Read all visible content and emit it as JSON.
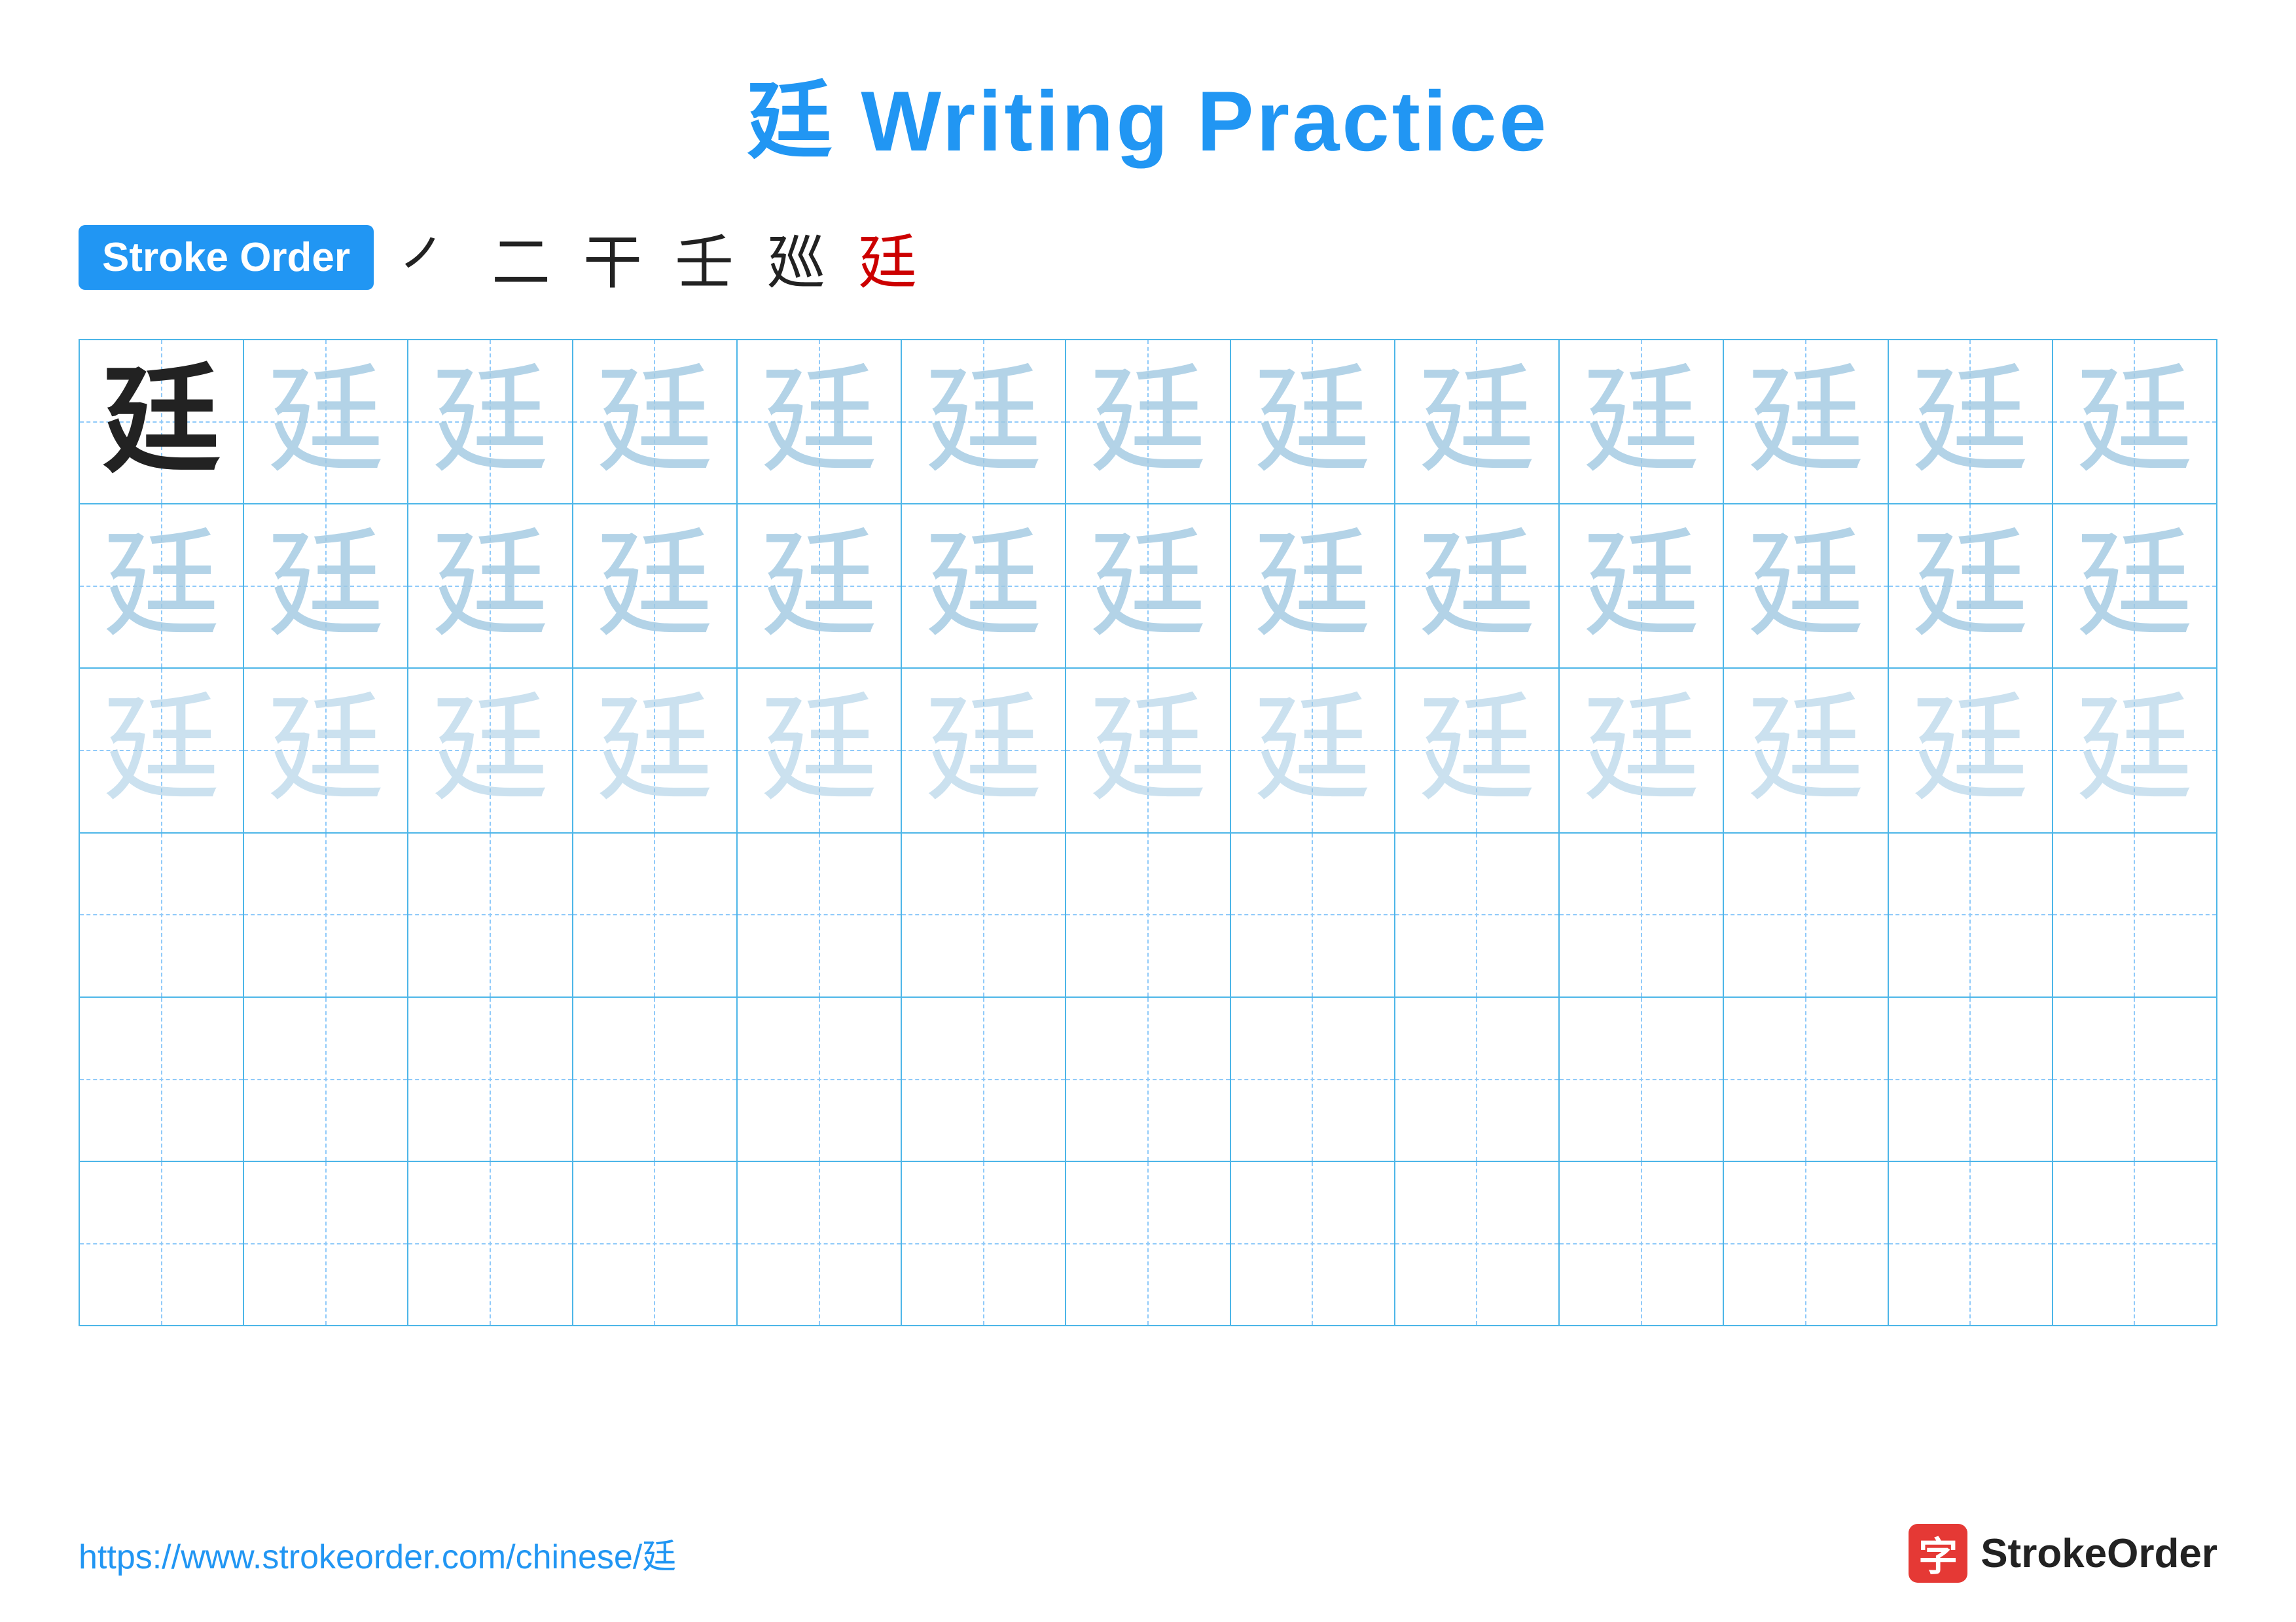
{
  "title": "廷 Writing Practice",
  "stroke_order": {
    "label": "Stroke Order",
    "steps": [
      "㇒",
      "二",
      "干",
      "壬",
      "廵",
      "廷"
    ]
  },
  "character": "廷",
  "grid": {
    "rows": 6,
    "cols": 13,
    "cells": [
      [
        "solid",
        "light1",
        "light1",
        "light1",
        "light1",
        "light1",
        "light1",
        "light1",
        "light1",
        "light1",
        "light1",
        "light1",
        "light1"
      ],
      [
        "light1",
        "light1",
        "light1",
        "light1",
        "light1",
        "light1",
        "light1",
        "light1",
        "light1",
        "light1",
        "light1",
        "light1",
        "light1"
      ],
      [
        "light2",
        "light2",
        "light2",
        "light2",
        "light2",
        "light2",
        "light2",
        "light2",
        "light2",
        "light2",
        "light2",
        "light2",
        "light2"
      ],
      [
        "empty",
        "empty",
        "empty",
        "empty",
        "empty",
        "empty",
        "empty",
        "empty",
        "empty",
        "empty",
        "empty",
        "empty",
        "empty"
      ],
      [
        "empty",
        "empty",
        "empty",
        "empty",
        "empty",
        "empty",
        "empty",
        "empty",
        "empty",
        "empty",
        "empty",
        "empty",
        "empty"
      ],
      [
        "empty",
        "empty",
        "empty",
        "empty",
        "empty",
        "empty",
        "empty",
        "empty",
        "empty",
        "empty",
        "empty",
        "empty",
        "empty"
      ]
    ]
  },
  "footer": {
    "url": "https://www.strokeorder.com/chinese/廷",
    "brand_char": "字",
    "brand_name": "StrokeOrder"
  }
}
